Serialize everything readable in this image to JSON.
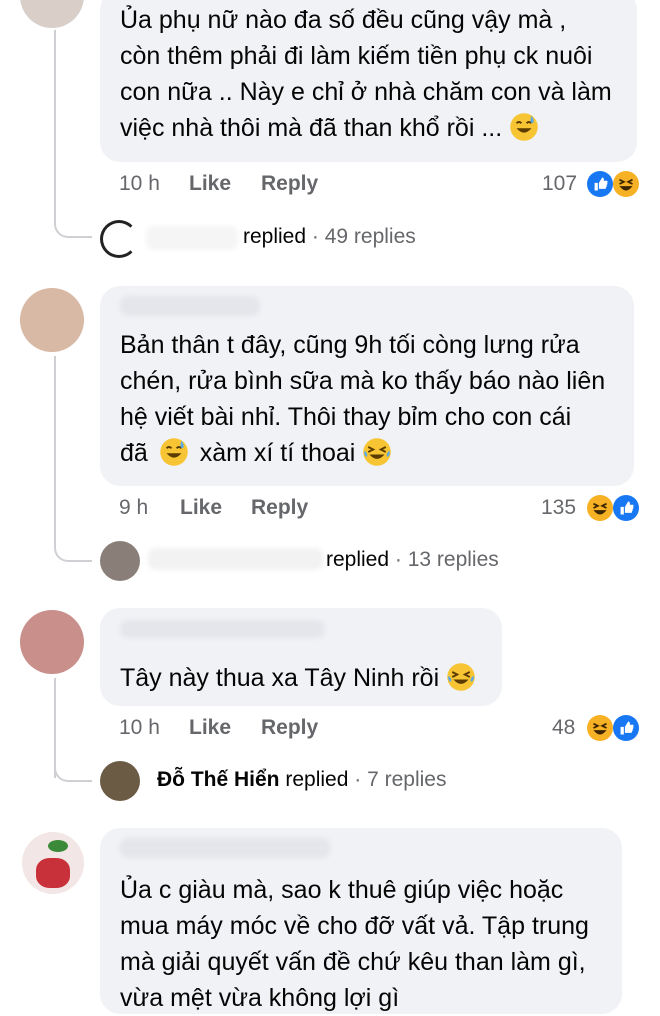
{
  "comments": [
    {
      "lines": [
        "Ủa phụ nữ nào đa số đều cũng vậy mà ,",
        "còn thêm phải đi làm kiếm tiền phụ ck nuôi",
        "con nữa .. Này e chỉ ở nhà chăm con và làm",
        "việc nhà thôi mà đã than khổ rồi ..."
      ],
      "time": "10 h",
      "like_label": "Like",
      "reply_label": "Reply",
      "reactions_count": "107",
      "reply_verb": "replied",
      "reply_name": "",
      "replies_count": "· 49 replies"
    },
    {
      "lines": [
        "Bản thân t đây, cũng 9h tối còng lưng rửa",
        "chén, rửa bình sữa mà ko thấy báo nào liên",
        "hệ viết bài nhỉ. Thôi thay bỉm cho con cái",
        "đã",
        "xàm xí tí thoai"
      ],
      "time": "9 h",
      "like_label": "Like",
      "reply_label": "Reply",
      "reactions_count": "135",
      "reply_verb": "replied",
      "replies_count": "· 13 replies"
    },
    {
      "lines": [
        "Tây này thua xa Tây Ninh rồi"
      ],
      "time": "10 h",
      "like_label": "Like",
      "reply_label": "Reply",
      "reactions_count": "48",
      "reply_name": "Đỗ Thế Hiển",
      "reply_verb": "replied",
      "replies_count": "· 7 replies"
    },
    {
      "lines": [
        "Ủa c giàu mà, sao k thuê giúp việc hoặc",
        "mua máy móc về cho đỡ vất vả. Tập trung",
        "mà giải quyết vấn đề chứ kêu than làm gì,",
        "vừa mệt vừa không lợi gì"
      ]
    }
  ],
  "icons": [
    "like-reaction-icon",
    "haha-reaction-icon",
    "sweat-smile-emoji-icon",
    "laughing-tears-emoji-icon"
  ],
  "colors": {
    "bubble": "#f0f2f5",
    "meta": "#65676b",
    "like": "#1877f2",
    "haha": "#f7b125"
  }
}
